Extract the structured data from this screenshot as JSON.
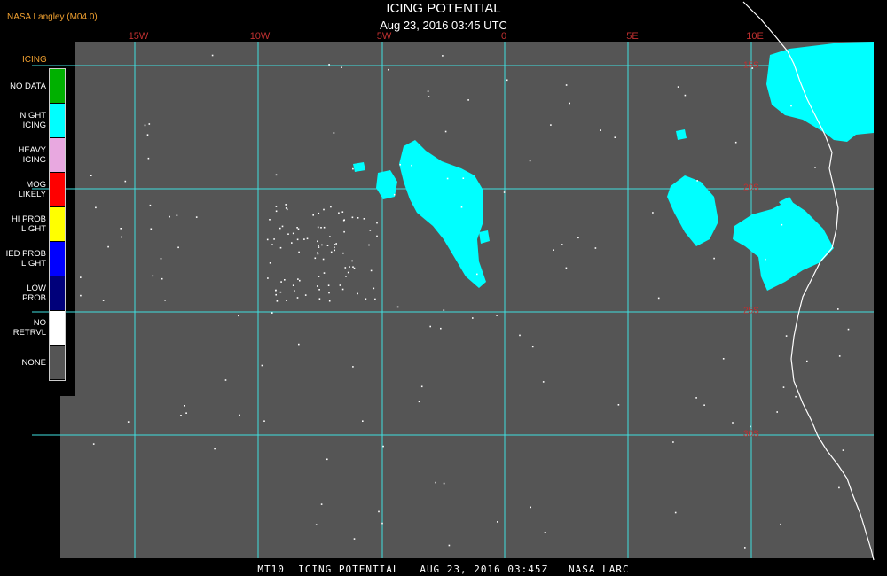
{
  "header": {
    "credit": "NASA Langley (M04.0)",
    "title": "ICING POTENTIAL",
    "subtitle": "Aug 23, 2016 03:45 UTC"
  },
  "map": {
    "longitude_labels": [
      "15W",
      "10W",
      "5W",
      "0",
      "5E",
      "10E"
    ],
    "latitude_labels": [
      "15S",
      "20S",
      "25S",
      "30S"
    ],
    "colors": {
      "background": "#555555",
      "gridlines": "#40e0e0",
      "coastline": "#ffffff",
      "icing_cells": "#00ffff"
    }
  },
  "legend": {
    "title": "ICING",
    "items": [
      {
        "label": [
          "NO DATA"
        ],
        "color": "#00b000"
      },
      {
        "label": [
          "NIGHT",
          "ICING"
        ],
        "color": "#00ffff"
      },
      {
        "label": [
          "HEAVY",
          "ICING"
        ],
        "color": "#e8a8e0"
      },
      {
        "label": [
          "MOG",
          "LIKELY"
        ],
        "color": "#ff0000"
      },
      {
        "label": [
          "HI PROB",
          "LIGHT"
        ],
        "color": "#ffff00"
      },
      {
        "label": [
          "IED PROB",
          "LIGHT"
        ],
        "color": "#0000ff"
      },
      {
        "label": [
          "LOW",
          "PROB"
        ],
        "color": "#00007a"
      },
      {
        "label": [
          "NO",
          "RETRVL"
        ],
        "color": "#ffffff"
      },
      {
        "label": [
          "NONE"
        ],
        "color": "#555555"
      }
    ]
  },
  "footer": {
    "caption": "MT10  ICING POTENTIAL   AUG 23, 2016 03:45Z   NASA LARC"
  }
}
